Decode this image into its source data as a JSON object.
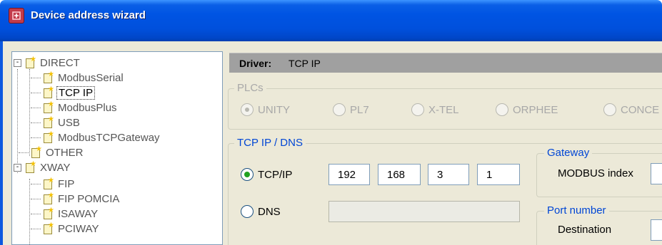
{
  "window": {
    "title": "Device address wizard",
    "icon": "wizard-app-icon",
    "title_bar_color": "#0054e3"
  },
  "tree": {
    "items": [
      {
        "label": "DIRECT",
        "expander": "-"
      },
      {
        "label": "ModbusSerial"
      },
      {
        "label": "TCP IP",
        "selected": true
      },
      {
        "label": "ModbusPlus"
      },
      {
        "label": "USB"
      },
      {
        "label": "ModbusTCPGateway"
      },
      {
        "label": "OTHER"
      },
      {
        "label": "XWAY",
        "expander": "-"
      },
      {
        "label": "FIP"
      },
      {
        "label": "FIP POMCIA"
      },
      {
        "label": "ISAWAY"
      },
      {
        "label": "PCIWAY"
      }
    ]
  },
  "driver": {
    "key": "Driver:",
    "value": "TCP IP"
  },
  "plcs": {
    "legend": "PLCs",
    "options": [
      {
        "label": "UNITY",
        "checked": true
      },
      {
        "label": "PL7",
        "checked": false
      },
      {
        "label": "X-TEL",
        "checked": false
      },
      {
        "label": "ORPHEE",
        "checked": false
      },
      {
        "label": "CONCE",
        "checked": false
      }
    ]
  },
  "tcpip_dns": {
    "legend": "TCP IP / DNS",
    "tcpip_label": "TCP/IP",
    "tcpip_checked": true,
    "dns_label": "DNS",
    "dns_checked": false,
    "ip": [
      "192",
      "168",
      "3",
      "1"
    ],
    "dns_value": ""
  },
  "gateway": {
    "legend": "Gateway",
    "modbus_index_label": "MODBUS index",
    "modbus_index_value": ""
  },
  "port": {
    "legend": "Port number",
    "destination_label": "Destination",
    "destination_value": ""
  },
  "colors": {
    "accent_blue": "#0046d5",
    "radio_on": "#21a121",
    "panel": "#ece9d8"
  }
}
